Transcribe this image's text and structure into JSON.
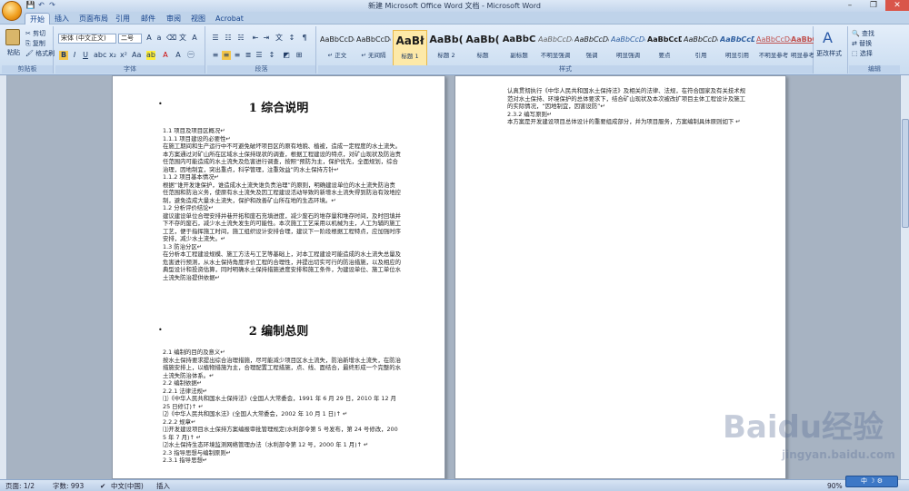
{
  "window": {
    "title": "新建 Microsoft Office Word 文档 - Microsoft Word"
  },
  "qat": {
    "save": "💾",
    "undo": "↶",
    "redo": "↷"
  },
  "tabs": [
    "开始",
    "插入",
    "页面布局",
    "引用",
    "邮件",
    "审阅",
    "视图",
    "Acrobat"
  ],
  "ribbon": {
    "clipboard": {
      "paste": "粘贴",
      "cut": "剪切",
      "copy": "复制",
      "format_painter": "格式刷",
      "label": "剪贴板"
    },
    "font": {
      "name": "宋体 (中文正文)",
      "size": "二号",
      "label": "字体"
    },
    "paragraph": {
      "label": "段落"
    },
    "styles": {
      "label": "样式",
      "items": [
        {
          "sample": "AaBbCcDd",
          "name": "↵ 正文"
        },
        {
          "sample": "AaBbCcDd",
          "name": "↵ 无间隔"
        },
        {
          "sample": "AaBł",
          "name": "标题 1"
        },
        {
          "sample": "AaBb(",
          "name": "标题 2"
        },
        {
          "sample": "AaBb(",
          "name": "标题"
        },
        {
          "sample": "AaBbC",
          "name": "副标题"
        },
        {
          "sample": "AaBbCcDd",
          "name": "不明显强调"
        },
        {
          "sample": "AaBbCcDd",
          "name": "强调"
        },
        {
          "sample": "AaBbCcDd",
          "name": "明显强调"
        },
        {
          "sample": "AaBbCcDd",
          "name": "要点"
        },
        {
          "sample": "AaBbCcDd",
          "name": "引用"
        },
        {
          "sample": "AaBbCcDd",
          "name": "明显引用"
        },
        {
          "sample": "AaBbCcDd",
          "name": "不明显参考"
        },
        {
          "sample": "AaBbCcDd",
          "name": "明显参考"
        }
      ],
      "change_styles": "更改样式"
    },
    "editing": {
      "find": "查找",
      "replace": "替换",
      "select": "选择",
      "label": "编辑"
    }
  },
  "page1": {
    "heading1": "1 综合说明",
    "section1_lines": [
      "1.1 项目及项目区概况↵",
      "1.1.1 项目建设的必要性↵",
      "在施工期间和生产运行中不可避免破坏项目区的原有地貌、植被，造成一定程度的水土流失。本方案通过对矿山所在区域水土保持现状的调查，根据工程建设的特点，对矿山现状及防治责任范围内可能造成的水土流失及危害进行调查，按照“预防为主，保护优先，全面规划，综合治理，因地制宜，突出重点，科学管理，注重效益”的水土保持方针↵",
      "1.1.2 项目基本情况↵",
      "根据“谁开发谁保护，谁造成水土流失谁负责治理”的原则，明确建设单位的水土流失防治责任范围和防治义务，使原有水土流失及因工程建设活动导致的新增水土流失得到防治有效地控制，避免造成大量水土流失，保护和改善矿山所在地的生态环境。↵",
      "1.2 分析评价结论↵",
      "建议建设单位合理安排并巷开拓和废石充填进度，减少废石的堆存量和堆存时间，及时回填并下不存的废石，减少水土流失发生的可能性。本次施工工艺采用以机械为主，人工为辅的施工工艺，便于指挥施工时间，施工组织设计安排合理，建议下一阶段根据工程特点，应加强时序安排，减少水土流失。↵",
      "1.3 防治分区↵",
      "在分析本工程建设规模、施工方法与工艺等基础上，对本工程建设可能造成的水土流失总量及危害进行预测，从水土保持角度评价工程的合理性，并提出切实可行的防治措施，以及相应的典型设计和投资估算，同时明确水土保持措施进度安排和施工条件，为建设单位、施工单位水土流失防治提供依据↵"
    ],
    "heading2": "2 编制总则",
    "section2_lines": [
      "2.1 编制的目的及意义↵",
      "按水土保持要求提出综合治理措施，尽可能减少项目区水土流失，防治新增水土流失，在防治措施安排上，以植物措施为主，合理配置工程措施，点、线、面结合，最终形成一个完整的水土流失防治体系。↵",
      "2.2 编制依据↵",
      "2.2.1 法律法规↵",
      "⑴《中华人民共和国水土保持法》(全国人大常委会，1991 年 6 月 29 日，2010 年 12 月 25 日修订)↑ ↵",
      "⑵《中华人民共和国水法》(全国人大常委会，2002 年 10 月 1 日)↑ ↵",
      "2.2.2 规章↵",
      "⑴开发建设项目水土保持方案编报审批管理规定(水利部令第 5 号发布，第 24 号修改，2005 年 7 月)↑ ↵",
      "⑵水土保持生态环境监测网络管理办法（水利部令第 12 号，2000 年 1 月)↑ ↵",
      "2.3 指导思想与编制原则↵",
      "2.3.1 指导思想↵"
    ]
  },
  "page2": {
    "lines": [
      "认真贯彻执行《中华人民共和国水土保持法》及相关的法律、法规，在符合国家及有关技术规范对水土保持、环境保护的总体要求下，结合矿山现状及本次被改扩项目主体工程设计及施工的实际情况，“因地制宜，因害设防”↵",
      "2.3.2 编写原则↵",
      "本方案是开发建设项目总体设计的重要组成部分，并为项目服务，方案编制具体原则如下 ↵"
    ]
  },
  "status": {
    "page": "页面: 1/2",
    "words": "字数: 993",
    "language": "中文(中国)",
    "mode": "插入",
    "zoom": "90%"
  },
  "watermark": {
    "brand": "Baidu经验",
    "url": "jingyan.baidu.com"
  },
  "ime": "中 ☽ ⚙"
}
